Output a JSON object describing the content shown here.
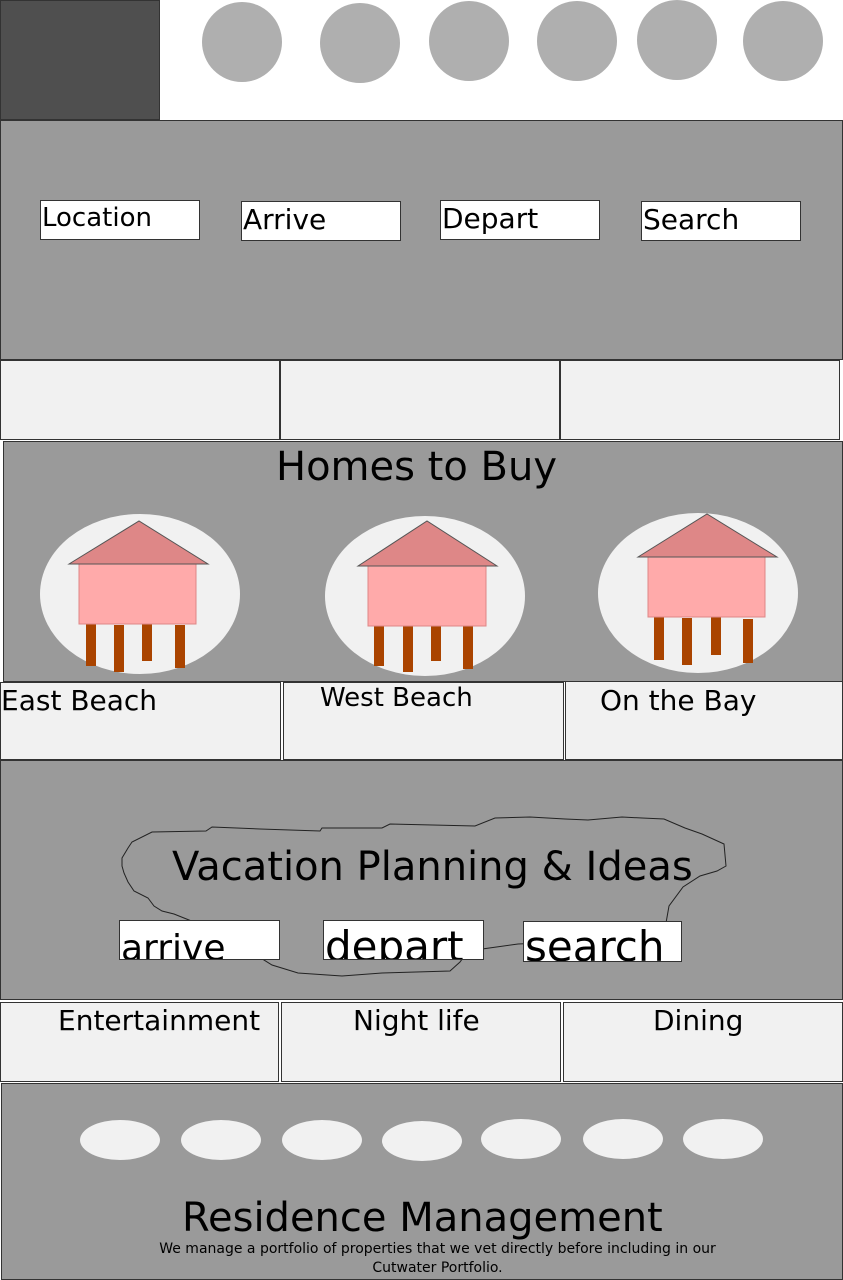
{
  "header": {
    "nav_circles": [
      "nav-circle-1",
      "nav-circle-2",
      "nav-circle-3",
      "nav-circle-4",
      "nav-circle-5",
      "nav-circle-6"
    ]
  },
  "search": {
    "location": "Location",
    "arrive": "Arrive",
    "depart": "Depart",
    "search": "Search"
  },
  "homes": {
    "title": "Homes to Buy",
    "locations": [
      "East Beach",
      "West Beach",
      "On the Bay"
    ]
  },
  "vacation": {
    "title": "Vacation Planning & Ideas",
    "arrive": "arrive",
    "depart": "depart",
    "search": "search",
    "categories": [
      "Entertainment",
      "Night life",
      "Dining"
    ]
  },
  "residence": {
    "title": "Residence Management",
    "description": "We manage a portfolio of properties that we vet directly before including in our Cutwater Portfolio."
  },
  "colors": {
    "band": "#9a9a9a",
    "tile": "#f1f1f1",
    "logo": "#4f4f4f",
    "roof": "#de8787",
    "house": "#ffaaaa",
    "stilt": "#aa4400"
  }
}
